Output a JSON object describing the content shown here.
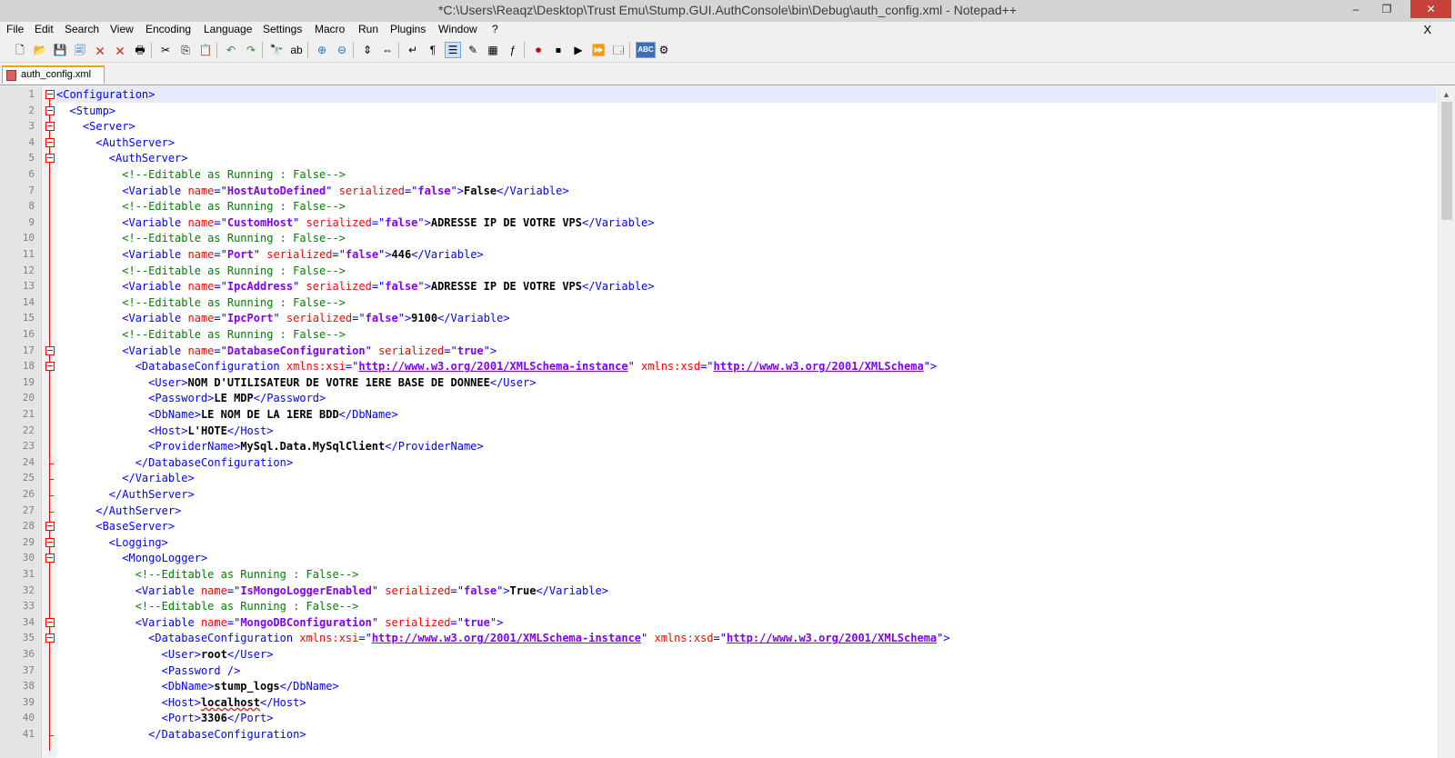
{
  "window": {
    "title": "*C:\\Users\\Reaqz\\Desktop\\Trust Emu\\Stump.GUI.AuthConsole\\bin\\Debug\\auth_config.xml - Notepad++",
    "minimize": "–",
    "maximize": "❐",
    "close": "✕"
  },
  "menu": {
    "items": [
      "File",
      "Edit",
      "Search",
      "View",
      "Encoding",
      "Language",
      "Settings",
      "Macro",
      "Run",
      "Plugins",
      "Window",
      "?"
    ],
    "close_doc": "X"
  },
  "toolbar": {
    "icons": [
      {
        "name": "new-file-icon",
        "glyph": "🗋"
      },
      {
        "name": "open-file-icon",
        "glyph": "📂"
      },
      {
        "name": "save-icon",
        "glyph": "💾"
      },
      {
        "name": "save-all-icon",
        "glyph": "🗐"
      },
      {
        "name": "close-icon",
        "glyph": "🗙"
      },
      {
        "name": "close-all-icon",
        "glyph": "🗙"
      },
      {
        "name": "print-icon",
        "glyph": "🖶"
      },
      {
        "name": "cut-icon",
        "glyph": "✂"
      },
      {
        "name": "copy-icon",
        "glyph": "⎘"
      },
      {
        "name": "paste-icon",
        "glyph": "📋"
      },
      {
        "name": "undo-icon",
        "glyph": "↶"
      },
      {
        "name": "redo-icon",
        "glyph": "↷"
      },
      {
        "name": "find-icon",
        "glyph": "🔭"
      },
      {
        "name": "replace-icon",
        "glyph": "ab"
      },
      {
        "name": "zoom-in-icon",
        "glyph": "⊕"
      },
      {
        "name": "zoom-out-icon",
        "glyph": "⊖"
      },
      {
        "name": "sync-vertical-icon",
        "glyph": "⇕"
      },
      {
        "name": "sync-horizontal-icon",
        "glyph": "⇔"
      },
      {
        "name": "word-wrap-icon",
        "glyph": "↵"
      },
      {
        "name": "show-all-chars-icon",
        "glyph": "¶"
      },
      {
        "name": "indent-guide-icon",
        "glyph": "☰"
      },
      {
        "name": "user-language-icon",
        "glyph": "✎"
      },
      {
        "name": "doc-map-icon",
        "glyph": "▦"
      },
      {
        "name": "function-list-icon",
        "glyph": "ƒ"
      },
      {
        "name": "record-macro-icon",
        "glyph": "⏺"
      },
      {
        "name": "stop-macro-icon",
        "glyph": "⏹"
      },
      {
        "name": "play-macro-icon",
        "glyph": "▶"
      },
      {
        "name": "run-macro-multiple-icon",
        "glyph": "⏩"
      },
      {
        "name": "save-macro-icon",
        "glyph": "🗔"
      },
      {
        "name": "spell-check-icon",
        "glyph": "ABC"
      },
      {
        "name": "spell-settings-icon",
        "glyph": "⚙"
      }
    ]
  },
  "tab": {
    "label": "auth_config.xml"
  },
  "editor": {
    "current_line": 1,
    "lines": [
      {
        "n": "1",
        "fold": "open",
        "parts": [
          [
            "tag",
            "<Configuration>"
          ]
        ]
      },
      {
        "n": "2",
        "fold": "open",
        "parts": [
          [
            "plain",
            "  "
          ],
          [
            "tag",
            "<Stump>"
          ]
        ]
      },
      {
        "n": "3",
        "fold": "open",
        "parts": [
          [
            "plain",
            "    "
          ],
          [
            "tag",
            "<Server>"
          ]
        ]
      },
      {
        "n": "4",
        "fold": "open",
        "parts": [
          [
            "plain",
            "      "
          ],
          [
            "tag",
            "<AuthServer>"
          ]
        ]
      },
      {
        "n": "5",
        "fold": "open",
        "parts": [
          [
            "plain",
            "        "
          ],
          [
            "tag",
            "<AuthServer>"
          ]
        ]
      },
      {
        "n": "6",
        "fold": "",
        "parts": [
          [
            "plain",
            "          "
          ],
          [
            "com",
            "<!--Editable as Running : False-->"
          ]
        ]
      },
      {
        "n": "7",
        "fold": "",
        "parts": [
          [
            "plain",
            "          "
          ],
          [
            "tag",
            "<Variable "
          ],
          [
            "attr",
            "name"
          ],
          [
            "tag",
            "=\""
          ],
          [
            "val",
            "HostAutoDefined"
          ],
          [
            "tag",
            "\" "
          ],
          [
            "attr",
            "serialized"
          ],
          [
            "tag",
            "=\""
          ],
          [
            "val",
            "false"
          ],
          [
            "tag",
            "\">"
          ],
          [
            "text",
            "False"
          ],
          [
            "tag",
            "</Variable>"
          ]
        ]
      },
      {
        "n": "8",
        "fold": "",
        "parts": [
          [
            "plain",
            "          "
          ],
          [
            "com",
            "<!--Editable as Running : False-->"
          ]
        ]
      },
      {
        "n": "9",
        "fold": "",
        "parts": [
          [
            "plain",
            "          "
          ],
          [
            "tag",
            "<Variable "
          ],
          [
            "attr",
            "name"
          ],
          [
            "tag",
            "=\""
          ],
          [
            "val",
            "CustomHost"
          ],
          [
            "tag",
            "\" "
          ],
          [
            "attr",
            "serialized"
          ],
          [
            "tag",
            "=\""
          ],
          [
            "val",
            "false"
          ],
          [
            "tag",
            "\">"
          ],
          [
            "text",
            "ADRESSE IP DE VOTRE VPS"
          ],
          [
            "tag",
            "</Variable>"
          ]
        ]
      },
      {
        "n": "10",
        "fold": "",
        "parts": [
          [
            "plain",
            "          "
          ],
          [
            "com",
            "<!--Editable as Running : False-->"
          ]
        ]
      },
      {
        "n": "11",
        "fold": "",
        "parts": [
          [
            "plain",
            "          "
          ],
          [
            "tag",
            "<Variable "
          ],
          [
            "attr",
            "name"
          ],
          [
            "tag",
            "=\""
          ],
          [
            "val",
            "Port"
          ],
          [
            "tag",
            "\" "
          ],
          [
            "attr",
            "serialized"
          ],
          [
            "tag",
            "=\""
          ],
          [
            "val",
            "false"
          ],
          [
            "tag",
            "\">"
          ],
          [
            "text",
            "446"
          ],
          [
            "tag",
            "</Variable>"
          ]
        ]
      },
      {
        "n": "12",
        "fold": "",
        "parts": [
          [
            "plain",
            "          "
          ],
          [
            "com",
            "<!--Editable as Running : False-->"
          ]
        ]
      },
      {
        "n": "13",
        "fold": "",
        "parts": [
          [
            "plain",
            "          "
          ],
          [
            "tag",
            "<Variable "
          ],
          [
            "attr",
            "name"
          ],
          [
            "tag",
            "=\""
          ],
          [
            "val",
            "IpcAddress"
          ],
          [
            "tag",
            "\" "
          ],
          [
            "attr",
            "serialized"
          ],
          [
            "tag",
            "=\""
          ],
          [
            "val",
            "false"
          ],
          [
            "tag",
            "\">"
          ],
          [
            "text",
            "ADRESSE IP DE VOTRE VPS"
          ],
          [
            "tag",
            "</Variable>"
          ]
        ]
      },
      {
        "n": "14",
        "fold": "",
        "parts": [
          [
            "plain",
            "          "
          ],
          [
            "com",
            "<!--Editable as Running : False-->"
          ]
        ]
      },
      {
        "n": "15",
        "fold": "",
        "parts": [
          [
            "plain",
            "          "
          ],
          [
            "tag",
            "<Variable "
          ],
          [
            "attr",
            "name"
          ],
          [
            "tag",
            "=\""
          ],
          [
            "val",
            "IpcPort"
          ],
          [
            "tag",
            "\" "
          ],
          [
            "attr",
            "serialized"
          ],
          [
            "tag",
            "=\""
          ],
          [
            "val",
            "false"
          ],
          [
            "tag",
            "\">"
          ],
          [
            "text",
            "9100"
          ],
          [
            "tag",
            "</Variable>"
          ]
        ]
      },
      {
        "n": "16",
        "fold": "",
        "parts": [
          [
            "plain",
            "          "
          ],
          [
            "com",
            "<!--Editable as Running : False-->"
          ]
        ]
      },
      {
        "n": "17",
        "fold": "open",
        "parts": [
          [
            "plain",
            "          "
          ],
          [
            "tag",
            "<Variable "
          ],
          [
            "attr",
            "name"
          ],
          [
            "tag",
            "=\""
          ],
          [
            "val",
            "DatabaseConfiguration"
          ],
          [
            "tag",
            "\" "
          ],
          [
            "attr",
            "serialized"
          ],
          [
            "tag",
            "=\""
          ],
          [
            "val",
            "true"
          ],
          [
            "tag",
            "\">"
          ]
        ]
      },
      {
        "n": "18",
        "fold": "open",
        "parts": [
          [
            "plain",
            "            "
          ],
          [
            "tag",
            "<DatabaseConfiguration "
          ],
          [
            "attr",
            "xmlns:xsi"
          ],
          [
            "tag",
            "=\""
          ],
          [
            "url",
            "http://www.w3.org/2001/XMLSchema-instance"
          ],
          [
            "tag",
            "\" "
          ],
          [
            "attr",
            "xmlns:xsd"
          ],
          [
            "tag",
            "=\""
          ],
          [
            "url",
            "http://www.w3.org/2001/XMLSchema"
          ],
          [
            "tag",
            "\">"
          ]
        ]
      },
      {
        "n": "19",
        "fold": "",
        "parts": [
          [
            "plain",
            "              "
          ],
          [
            "tag",
            "<User>"
          ],
          [
            "text",
            "NOM D'UTILISATEUR DE VOTRE 1ERE BASE DE DONNEE"
          ],
          [
            "tag",
            "</User>"
          ]
        ]
      },
      {
        "n": "20",
        "fold": "",
        "parts": [
          [
            "plain",
            "              "
          ],
          [
            "tag",
            "<Password>"
          ],
          [
            "text",
            "LE MDP"
          ],
          [
            "tag",
            "</Password>"
          ]
        ]
      },
      {
        "n": "21",
        "fold": "",
        "parts": [
          [
            "plain",
            "              "
          ],
          [
            "tag",
            "<DbName>"
          ],
          [
            "text",
            "LE NOM DE LA 1ERE BDD"
          ],
          [
            "tag",
            "</DbName>"
          ]
        ]
      },
      {
        "n": "22",
        "fold": "",
        "parts": [
          [
            "plain",
            "              "
          ],
          [
            "tag",
            "<Host>"
          ],
          [
            "text",
            "L'HOTE"
          ],
          [
            "tag",
            "</Host>"
          ]
        ]
      },
      {
        "n": "23",
        "fold": "",
        "parts": [
          [
            "plain",
            "              "
          ],
          [
            "tag",
            "<ProviderName>"
          ],
          [
            "text",
            "MySql.Data.MySqlClient"
          ],
          [
            "tag",
            "</ProviderName>"
          ]
        ]
      },
      {
        "n": "24",
        "fold": "end",
        "parts": [
          [
            "plain",
            "            "
          ],
          [
            "tag",
            "</DatabaseConfiguration>"
          ]
        ]
      },
      {
        "n": "25",
        "fold": "end",
        "parts": [
          [
            "plain",
            "          "
          ],
          [
            "tag",
            "</Variable>"
          ]
        ]
      },
      {
        "n": "26",
        "fold": "end",
        "parts": [
          [
            "plain",
            "        "
          ],
          [
            "tag",
            "</AuthServer>"
          ]
        ]
      },
      {
        "n": "27",
        "fold": "end",
        "parts": [
          [
            "plain",
            "      "
          ],
          [
            "tag",
            "</AuthServer>"
          ]
        ]
      },
      {
        "n": "28",
        "fold": "open",
        "parts": [
          [
            "plain",
            "      "
          ],
          [
            "tag",
            "<BaseServer>"
          ]
        ]
      },
      {
        "n": "29",
        "fold": "open",
        "parts": [
          [
            "plain",
            "        "
          ],
          [
            "tag",
            "<Logging>"
          ]
        ]
      },
      {
        "n": "30",
        "fold": "open",
        "parts": [
          [
            "plain",
            "          "
          ],
          [
            "tag",
            "<MongoLogger>"
          ]
        ]
      },
      {
        "n": "31",
        "fold": "",
        "parts": [
          [
            "plain",
            "            "
          ],
          [
            "com",
            "<!--Editable as Running : False-->"
          ]
        ]
      },
      {
        "n": "32",
        "fold": "",
        "parts": [
          [
            "plain",
            "            "
          ],
          [
            "tag",
            "<Variable "
          ],
          [
            "attr",
            "name"
          ],
          [
            "tag",
            "=\""
          ],
          [
            "val",
            "IsMongoLoggerEnabled"
          ],
          [
            "tag",
            "\" "
          ],
          [
            "attr",
            "serialized"
          ],
          [
            "tag",
            "=\""
          ],
          [
            "val",
            "false"
          ],
          [
            "tag",
            "\">"
          ],
          [
            "text",
            "True"
          ],
          [
            "tag",
            "</Variable>"
          ]
        ]
      },
      {
        "n": "33",
        "fold": "",
        "parts": [
          [
            "plain",
            "            "
          ],
          [
            "com",
            "<!--Editable as Running : False-->"
          ]
        ]
      },
      {
        "n": "34",
        "fold": "open",
        "parts": [
          [
            "plain",
            "            "
          ],
          [
            "tag",
            "<Variable "
          ],
          [
            "attr",
            "name"
          ],
          [
            "tag",
            "=\""
          ],
          [
            "val",
            "MongoDBConfiguration"
          ],
          [
            "tag",
            "\" "
          ],
          [
            "attr",
            "serialized"
          ],
          [
            "tag",
            "=\""
          ],
          [
            "val",
            "true"
          ],
          [
            "tag",
            "\">"
          ]
        ]
      },
      {
        "n": "35",
        "fold": "open",
        "parts": [
          [
            "plain",
            "              "
          ],
          [
            "tag",
            "<DatabaseConfiguration "
          ],
          [
            "attr",
            "xmlns:xsi"
          ],
          [
            "tag",
            "=\""
          ],
          [
            "url",
            "http://www.w3.org/2001/XMLSchema-instance"
          ],
          [
            "tag",
            "\" "
          ],
          [
            "attr",
            "xmlns:xsd"
          ],
          [
            "tag",
            "=\""
          ],
          [
            "url",
            "http://www.w3.org/2001/XMLSchema"
          ],
          [
            "tag",
            "\">"
          ]
        ]
      },
      {
        "n": "36",
        "fold": "",
        "parts": [
          [
            "plain",
            "                "
          ],
          [
            "tag",
            "<User>"
          ],
          [
            "text",
            "root"
          ],
          [
            "tag",
            "</User>"
          ]
        ]
      },
      {
        "n": "37",
        "fold": "",
        "parts": [
          [
            "plain",
            "                "
          ],
          [
            "tag",
            "<Password />"
          ]
        ]
      },
      {
        "n": "38",
        "fold": "",
        "parts": [
          [
            "plain",
            "                "
          ],
          [
            "tag",
            "<DbName>"
          ],
          [
            "text",
            "stump_logs"
          ],
          [
            "tag",
            "</DbName>"
          ]
        ]
      },
      {
        "n": "39",
        "fold": "",
        "parts": [
          [
            "plain",
            "                "
          ],
          [
            "tag",
            "<Host>"
          ],
          [
            "spell",
            "localhost"
          ],
          [
            "tag",
            "</Host>"
          ]
        ]
      },
      {
        "n": "40",
        "fold": "",
        "parts": [
          [
            "plain",
            "                "
          ],
          [
            "tag",
            "<Port>"
          ],
          [
            "text",
            "3306"
          ],
          [
            "tag",
            "</Port>"
          ]
        ]
      },
      {
        "n": "41",
        "fold": "end",
        "parts": [
          [
            "plain",
            "              "
          ],
          [
            "tag",
            "</DatabaseConfiguration>"
          ]
        ]
      }
    ]
  },
  "colors": {
    "tag": "#0000ff",
    "attr": "#ff0000",
    "value": "#8000ff",
    "comment": "#008000",
    "fold_marker": "#ff0000",
    "current_line": "#e8e8ff"
  }
}
